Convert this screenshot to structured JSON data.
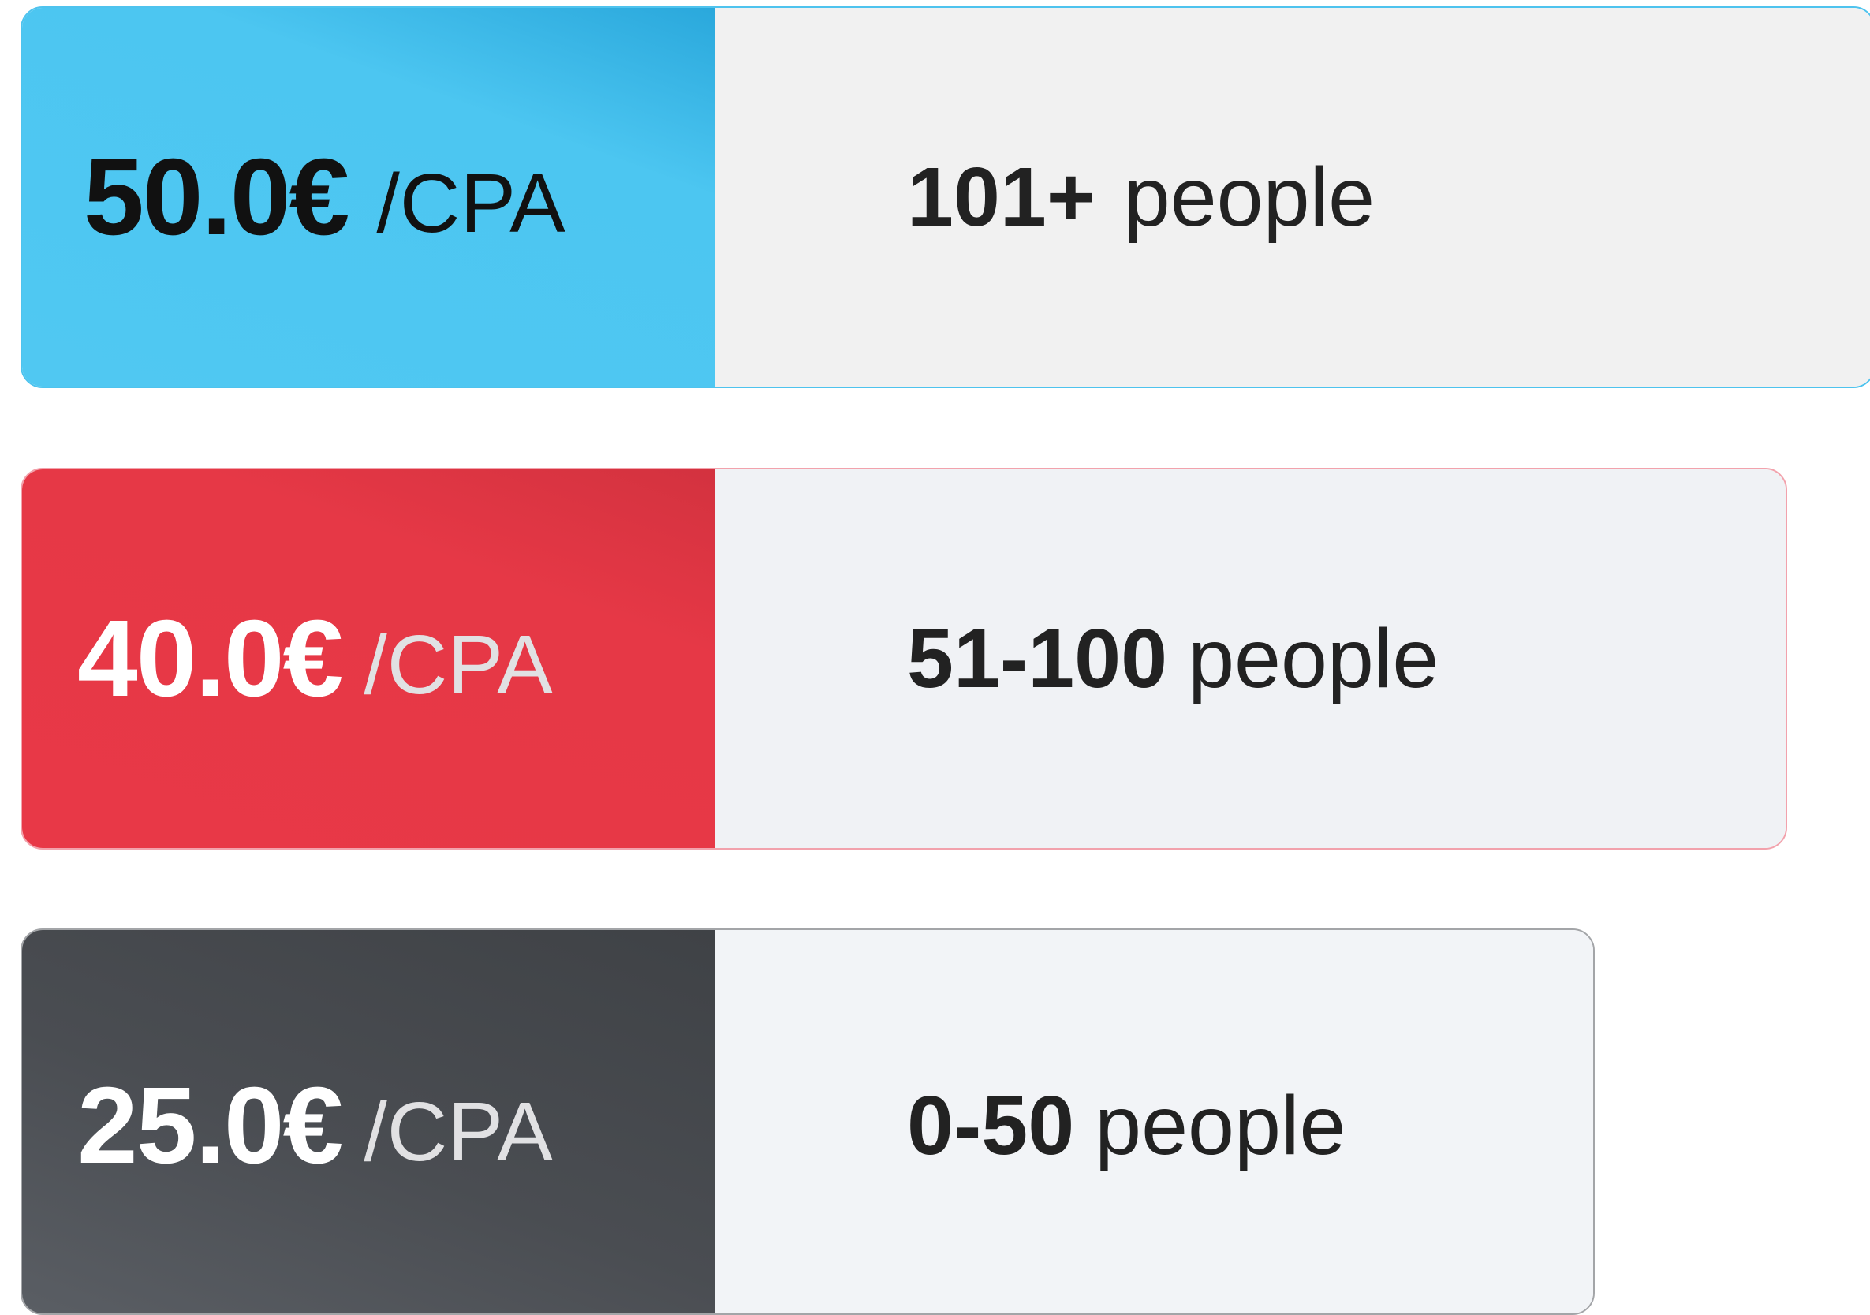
{
  "tiers": [
    {
      "price": "50.0€",
      "unit": "/CPA",
      "range": "101+",
      "range_unit": "people",
      "accent_color": "#4fc8f2",
      "price_text_color": "#111111"
    },
    {
      "price": "40.0€",
      "unit": "/CPA",
      "range": "51-100",
      "range_unit": "people",
      "accent_color": "#e83847",
      "price_text_color": "#ffffff"
    },
    {
      "price": "25.0€",
      "unit": "/CPA",
      "range": "0-50",
      "range_unit": "people",
      "accent_color": "#4a4d52",
      "price_text_color": "#ffffff"
    }
  ]
}
